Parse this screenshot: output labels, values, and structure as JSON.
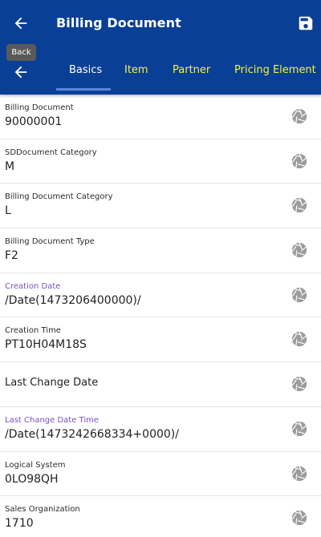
{
  "header": {
    "title": "Billing Document",
    "tooltip": "Back",
    "colors": {
      "appbar": "#0a3f96",
      "active_tab": "#ffffff",
      "inactive_tab": "#f2f53a",
      "underline": "#5b88d8"
    }
  },
  "tabs": [
    {
      "label": "Basics",
      "active": true
    },
    {
      "label": "Item",
      "active": false
    },
    {
      "label": "Partner",
      "active": false
    },
    {
      "label": "Pricing Element",
      "active": false
    }
  ],
  "fields": [
    {
      "label": "Billing Document",
      "value": "90000001",
      "icon": "aperture-icon"
    },
    {
      "label": "SDDocument Category",
      "value": "M",
      "icon": "aperture-icon"
    },
    {
      "label": "Billing Document Category",
      "value": "L",
      "icon": "aperture-icon"
    },
    {
      "label": "Billing Document Type",
      "value": "F2",
      "icon": "aperture-icon"
    },
    {
      "label": "Creation Date",
      "value": "/Date(1473206400000)/",
      "icon": "aperture-icon",
      "label_color": "#7b4fc8"
    },
    {
      "label": "Creation Time",
      "value": "PT10H04M18S",
      "icon": "aperture-icon"
    },
    {
      "label": "Last Change Date",
      "value": "",
      "icon": "aperture-icon"
    },
    {
      "label": "Last Change Date Time",
      "value": "/Date(1473242668334+0000)/",
      "icon": "aperture-icon",
      "label_color": "#7b4fc8"
    },
    {
      "label": "Logical System",
      "value": "0LO98QH",
      "icon": "aperture-icon"
    },
    {
      "label": "Sales Organization",
      "value": "1710",
      "icon": "aperture-icon"
    }
  ]
}
